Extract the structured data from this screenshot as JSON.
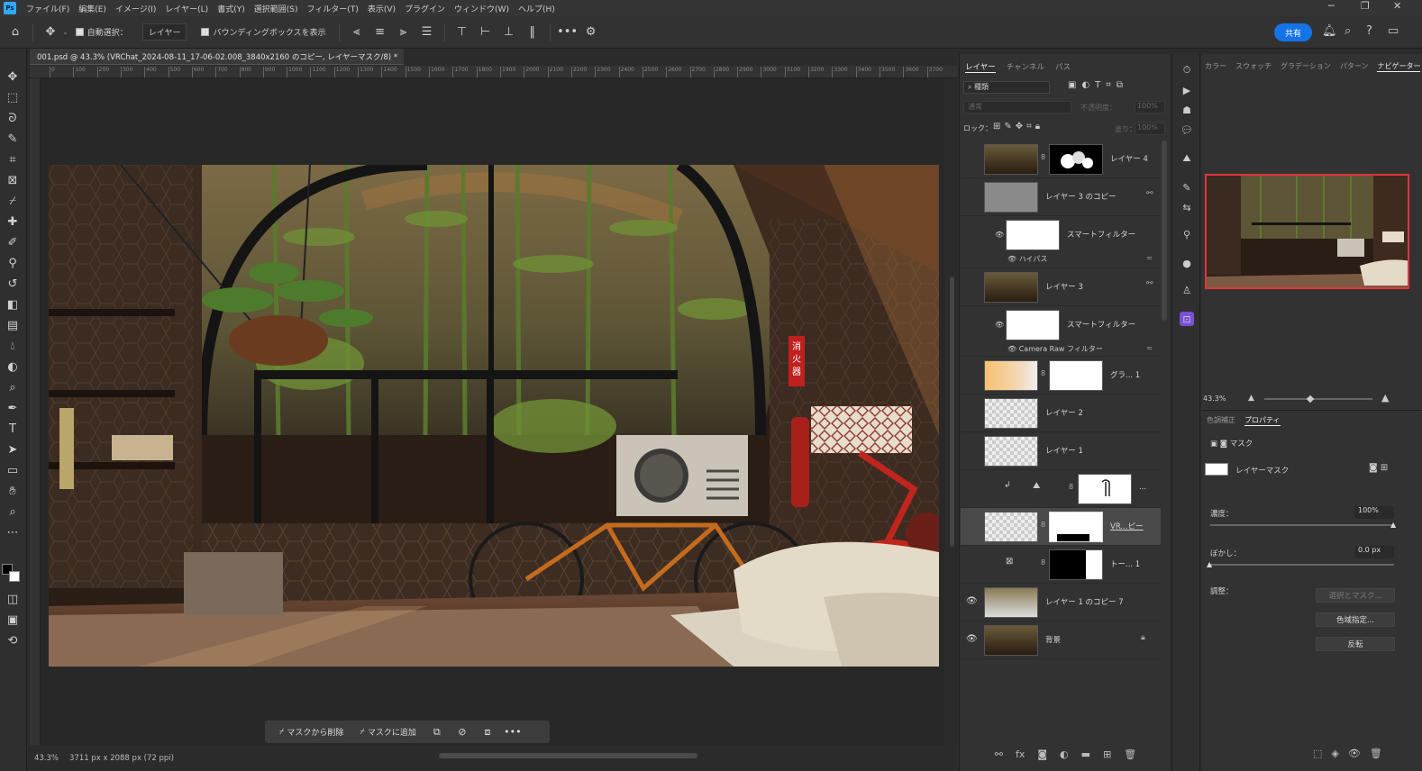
{
  "menubar": {
    "app_icon": "Ps",
    "items": [
      "ファイル(F)",
      "編集(E)",
      "イメージ(I)",
      "レイヤー(L)",
      "書式(Y)",
      "選択範囲(S)",
      "フィルター(T)",
      "表示(V)",
      "プラグイン",
      "ウィンドウ(W)",
      "ヘルプ(H)"
    ]
  },
  "options": {
    "auto_select": "自動選択：",
    "target": "レイヤー",
    "bounding_box": "バウンディングボックスを表示",
    "more": "•••",
    "share": "共有"
  },
  "document": {
    "tab_title": "001.psd @ 43.3% (VRChat_2024-08-11_17-06-02.008_3840x2160 のコピー, レイヤーマスク/8) *",
    "zoom": "43.3%",
    "size_info": "3711 px x 2088 px (72 ppi)"
  },
  "ruler_marks": [
    "0",
    "100",
    "200",
    "300",
    "400",
    "500",
    "600",
    "700",
    "800",
    "900",
    "1000",
    "1100",
    "1200",
    "1300",
    "1400",
    "1500",
    "1600",
    "1700",
    "1800",
    "1900",
    "2000",
    "2100",
    "2200",
    "2300",
    "2400",
    "2500",
    "2600",
    "2700",
    "2800",
    "2900",
    "3000",
    "3100",
    "3200",
    "3300",
    "3400",
    "3500",
    "3600",
    "3700"
  ],
  "taskbar": {
    "remove_from_mask": "マスクから削除",
    "add_to_mask": "マスクに追加",
    "more": "•••"
  },
  "layers_panel": {
    "tabs": [
      "レイヤー",
      "チャンネル",
      "パス"
    ],
    "filter_kind": "種類",
    "blend_mode": "通常",
    "opacity_label": "不透明度：",
    "opacity_value": "100%",
    "lock_label": "ロック：",
    "fill_label": "塗り：",
    "fill_value": "100%",
    "layers": [
      {
        "name": "レイヤー 4"
      },
      {
        "name": "レイヤー 3 のコピー"
      },
      {
        "name": "スマートフィルター",
        "sub": "ハイパス"
      },
      {
        "name": "レイヤー 3"
      },
      {
        "name": "スマートフィルター",
        "sub": "Camera Raw フィルター"
      },
      {
        "name": "グラ... 1"
      },
      {
        "name": "レイヤー 2"
      },
      {
        "name": "レイヤー 1"
      },
      {
        "name": "..."
      },
      {
        "name": "VR...ピー"
      },
      {
        "name": "トー... 1"
      },
      {
        "name": "レイヤー 1 のコピー 7"
      },
      {
        "name": "背景"
      }
    ]
  },
  "right_panel": {
    "tabs": [
      "カラー",
      "スウォッチ",
      "グラデーション",
      "パターン",
      "ナビゲーター"
    ],
    "nav_zoom": "43.3%",
    "prop_tabs": [
      "色調補正",
      "プロパティ"
    ],
    "mask_header": "マスク",
    "layer_mask": "レイヤーマスク",
    "density_label": "濃度：",
    "density_value": "100%",
    "feather_label": "ぼかし：",
    "feather_value": "0.0 px",
    "adjust_label": "調整：",
    "select_mask": "選択とマスク...",
    "color_range": "色域指定...",
    "invert": "反転"
  },
  "colors": {
    "accent": "#1473e6",
    "nav_frame": "#e0343a",
    "fire_sign": "#c0201e"
  },
  "photo": {
    "sign_text": "消火器"
  }
}
